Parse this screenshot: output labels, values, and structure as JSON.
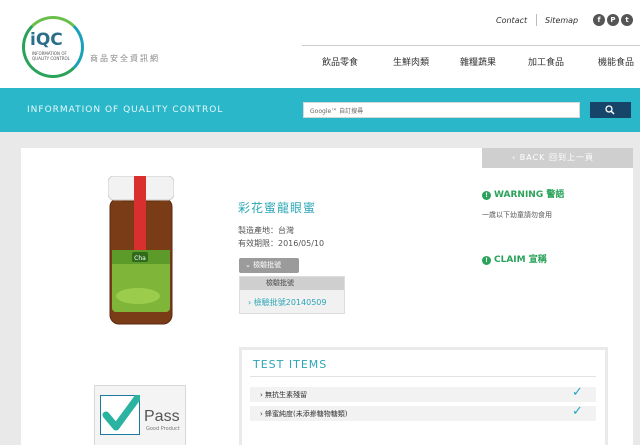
{
  "brand": {
    "logo_text": "iQC",
    "logo_subtitle": "INFORMATION OF QUALITY CONTROL",
    "site_name": "商品安全資訊網"
  },
  "utility": {
    "contact": "Contact",
    "sitemap": "Sitemap",
    "social": [
      "f",
      "P",
      "t"
    ]
  },
  "nav": {
    "items": [
      "飲品零食",
      "生鮮肉類",
      "雜糧蔬果",
      "加工食品",
      "機能食品"
    ]
  },
  "banner": {
    "title": "INFORMATION OF QUALITY CONTROL",
    "search_placeholder": "Google™ 自訂搜尋"
  },
  "back": {
    "label": "BACK 回到上一頁"
  },
  "product": {
    "title": "彩花蜜龍眼蜜",
    "origin": "製造產地：台灣",
    "expiry": "有效期限：2016/05/10",
    "label_text": "Cha",
    "batch_button": "檢驗批號",
    "batch_header": "檢驗批號",
    "batch_item": "檢驗批號20140509"
  },
  "warning": {
    "title": "WARNING 警語",
    "desc": "一歲以下幼童請勿食用"
  },
  "claim": {
    "title": "CLAIM 宣稱"
  },
  "tests": {
    "title": "TEST ITEMS",
    "items": [
      {
        "label": "無抗生素殘留",
        "passed": true
      },
      {
        "label": "蜂蜜純度(未添摻糖物糖類)",
        "passed": true
      }
    ]
  },
  "pass_badge": {
    "label": "Pass",
    "sub": "Good Product"
  },
  "colors": {
    "accent": "#29b7c9",
    "green": "#2aa35a",
    "navy": "#17456a",
    "teal_text": "#2ba6b6"
  }
}
